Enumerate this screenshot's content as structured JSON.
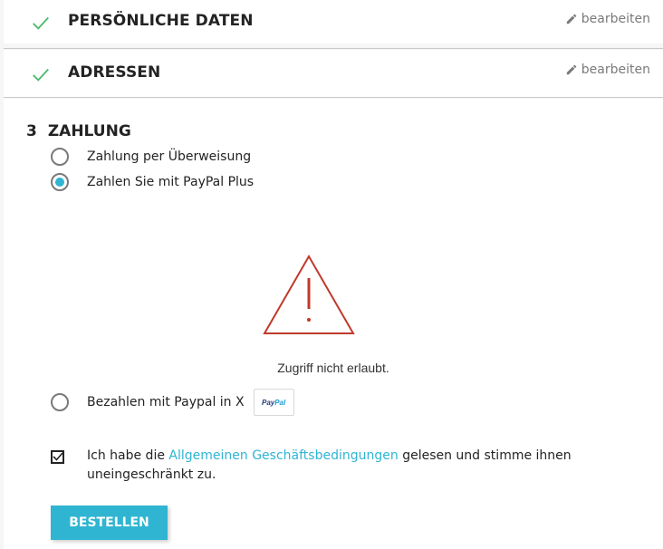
{
  "steps": [
    {
      "title": "PERSÖNLICHE DATEN",
      "edit_label": "bearbeiten"
    },
    {
      "title": "ADRESSEN",
      "edit_label": "bearbeiten"
    }
  ],
  "payment_step": {
    "number": "3",
    "title": "ZAHLUNG",
    "options": [
      {
        "label": "Zahlung per Überweisung",
        "selected": false
      },
      {
        "label": "Zahlen Sie mit PayPal Plus",
        "selected": true
      },
      {
        "label": "Bezahlen mit Paypal in X",
        "selected": false
      }
    ],
    "warning_message": "Zugriff nicht erlaubt.",
    "paypal_badge": {
      "pay": "Pay",
      "pal": "Pal"
    }
  },
  "terms": {
    "checked": true,
    "prefix": "Ich habe die ",
    "link": "Allgemeinen Geschäftsbedingungen",
    "suffix": " gelesen und stimme ihnen uneingeschränkt zu."
  },
  "order_button_label": "BESTELLEN",
  "colors": {
    "accent": "#2fb5d2",
    "check_green": "#4cbb6c",
    "warning_red": "#c0392b"
  }
}
